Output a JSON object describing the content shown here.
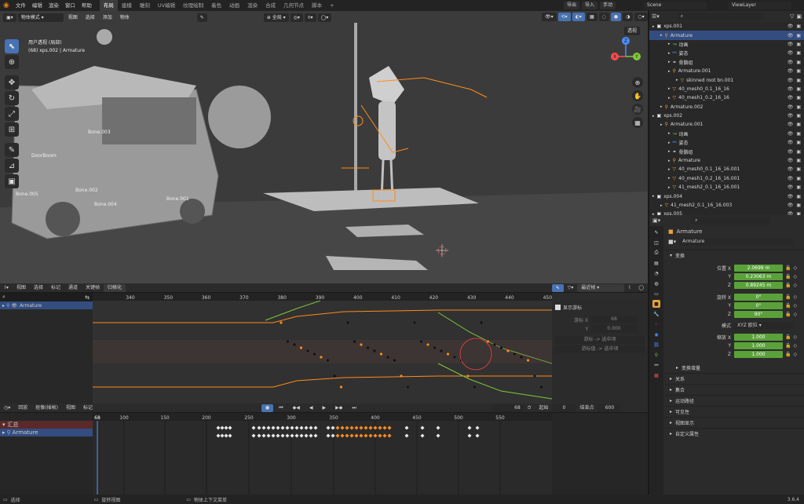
{
  "topbar": {
    "menus": [
      "文件",
      "编辑",
      "渲染",
      "窗口",
      "帮助"
    ],
    "workspaces": [
      "布局",
      "建模",
      "雕刻",
      "UV编辑",
      "纹理绘制",
      "着色",
      "动画",
      "渲染",
      "合成",
      "几何节点",
      "脚本"
    ],
    "active_workspace": "布局",
    "right_buttons": [
      "导出",
      "导入",
      "手动"
    ],
    "scene": "Scene",
    "view_layer": "ViewLayer"
  },
  "viewport": {
    "mode": "物体模式",
    "menus": [
      "视图",
      "选择",
      "添加",
      "物体"
    ],
    "transform_orientation": "全局",
    "overlay_label": "透视",
    "info_line1": "用户透视 (局部)",
    "info_line2": "(68) xps.002 | Armature",
    "bone_labels": [
      "Bone.003",
      "DoorBoom",
      "Bone.002",
      "Bone.005",
      "Bone.004",
      "Bone.001"
    ],
    "axes": [
      "X",
      "Y",
      "Z"
    ]
  },
  "graph_editor": {
    "menus": [
      "视图",
      "选择",
      "标记",
      "通道",
      "关键帧"
    ],
    "normalize": "归格化",
    "interp": "最近帧",
    "channel": "Armature",
    "ruler": [
      "340",
      "350",
      "360",
      "370",
      "380",
      "390",
      "400",
      "410",
      "420",
      "430",
      "440",
      "450"
    ],
    "sidebar_title": "显示游标",
    "cursor_x_label": "游标 X",
    "cursor_x_value": "68",
    "cursor_y_label": "Y",
    "cursor_y_value": "0.000",
    "btn_cursor_to_sel": "游标 -> 选中项",
    "btn_cursor_val_to_sel": "游标值 -> 选中项"
  },
  "timeline": {
    "menus": [
      "回放",
      "抠像(插帧)",
      "视图",
      "标记"
    ],
    "current_frame": "68",
    "start_label": "起始",
    "start_value": "0",
    "end_label": "结束点",
    "end_value": "600",
    "ruler": [
      "68",
      "100",
      "150",
      "200",
      "250",
      "300",
      "350",
      "400",
      "450",
      "500",
      "550"
    ],
    "summary": "汇总",
    "channel": "Armature"
  },
  "status": {
    "select": "选择",
    "rotate": "旋转视图",
    "context": "物体上下文菜单",
    "version": "3.6.4"
  },
  "outliner": {
    "rows": [
      {
        "label": "xps.001",
        "indent": 0,
        "kind": "collection"
      },
      {
        "label": "Armature",
        "indent": 1,
        "kind": "armature",
        "selected": true
      },
      {
        "label": "动画",
        "indent": 2,
        "kind": "anim"
      },
      {
        "label": "姿态",
        "indent": 2,
        "kind": "pose"
      },
      {
        "label": "骨骼组",
        "indent": 2,
        "kind": "group"
      },
      {
        "label": "Armature.001",
        "indent": 2,
        "kind": "armature"
      },
      {
        "label": "skinned root bn.001",
        "indent": 3,
        "kind": "mesh"
      },
      {
        "label": "40_mesh0_0.1_16_16",
        "indent": 2,
        "kind": "mesh"
      },
      {
        "label": "40_mesh1_0.2_16_16",
        "indent": 2,
        "kind": "mesh"
      },
      {
        "label": "Armature.002",
        "indent": 1,
        "kind": "armature"
      },
      {
        "label": "xps.002",
        "indent": 0,
        "kind": "collection"
      },
      {
        "label": "Armature.001",
        "indent": 1,
        "kind": "armature"
      },
      {
        "label": "动画",
        "indent": 2,
        "kind": "anim"
      },
      {
        "label": "姿态",
        "indent": 2,
        "kind": "pose"
      },
      {
        "label": "骨骼组",
        "indent": 2,
        "kind": "group"
      },
      {
        "label": "Armature",
        "indent": 2,
        "kind": "armature"
      },
      {
        "label": "40_mesh0_0.1_16_16.001",
        "indent": 2,
        "kind": "mesh"
      },
      {
        "label": "40_mesh1_0.2_16_16.001",
        "indent": 2,
        "kind": "mesh"
      },
      {
        "label": "41_mesh2_0.1_16_16.001",
        "indent": 2,
        "kind": "mesh"
      },
      {
        "label": "xps.004",
        "indent": 0,
        "kind": "collection"
      },
      {
        "label": "41_mesh2_0.1_16_16.003",
        "indent": 1,
        "kind": "mesh"
      },
      {
        "label": "xps.005",
        "indent": 0,
        "kind": "collection"
      }
    ]
  },
  "properties": {
    "object_name": "Armature",
    "datablock": "Armature",
    "transform": "变换",
    "location_label": "位置 X",
    "location": [
      "2.0699 m",
      "0.23063 m",
      "0.89245 m"
    ],
    "rotation_label": "旋转 X",
    "rotation": [
      "0°",
      "0°",
      "90°"
    ],
    "mode_label": "模式",
    "mode_value": "XYZ 欧拉",
    "scale_label": "缩放 X",
    "scale": [
      "1.000",
      "1.000",
      "1.000"
    ],
    "axis_y": "Y",
    "axis_z": "Z",
    "delta": "变换增量",
    "sections": [
      "关系",
      "集合",
      "运动路径",
      "可见性",
      "视图显示",
      "自定义属性"
    ]
  },
  "colors": {
    "accent": "#4772b3",
    "field_green": "#5aa13a",
    "orange": "#ff8c1a"
  }
}
